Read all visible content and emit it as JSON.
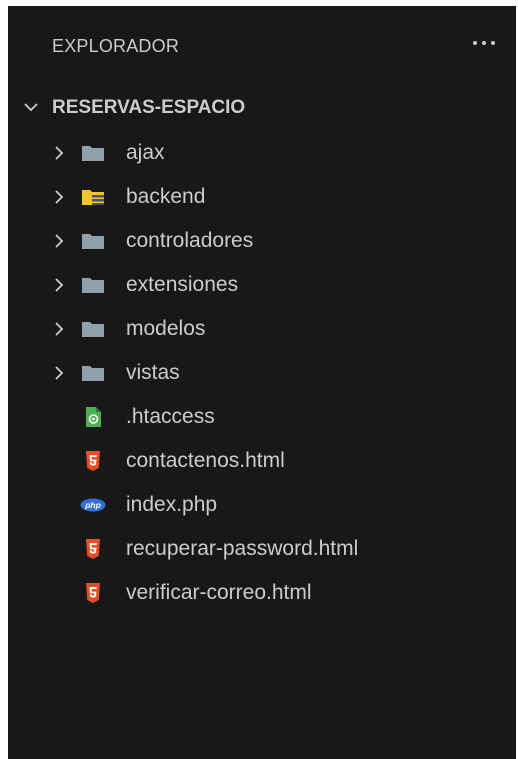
{
  "explorer": {
    "title": "EXPLORADOR",
    "more_actions": "...",
    "root": {
      "label": "RESERVAS-ESPACIO",
      "expanded": true
    },
    "items": [
      {
        "label": "ajax",
        "kind": "folder",
        "icon": "folder-icon"
      },
      {
        "label": "backend",
        "kind": "folder",
        "icon": "folder-backend-icon"
      },
      {
        "label": "controladores",
        "kind": "folder",
        "icon": "folder-icon"
      },
      {
        "label": "extensiones",
        "kind": "folder",
        "icon": "folder-icon"
      },
      {
        "label": "modelos",
        "kind": "folder",
        "icon": "folder-icon"
      },
      {
        "label": "vistas",
        "kind": "folder",
        "icon": "folder-icon"
      },
      {
        "label": ".htaccess",
        "kind": "file",
        "icon": "htaccess-file-icon"
      },
      {
        "label": "contactenos.html",
        "kind": "file",
        "icon": "html5-file-icon"
      },
      {
        "label": "index.php",
        "kind": "file",
        "icon": "php-file-icon"
      },
      {
        "label": "recuperar-password.html",
        "kind": "file",
        "icon": "html5-file-icon"
      },
      {
        "label": "verificar-correo.html",
        "kind": "file",
        "icon": "html5-file-icon"
      }
    ]
  },
  "colors": {
    "panel_background": "#181818",
    "text": "#cccccc",
    "folder": "#8ea1ad",
    "folder_backend": "#f7c427",
    "html5": "#e44d26",
    "php": "#2f6fd8",
    "htaccess": "#4caf50"
  }
}
